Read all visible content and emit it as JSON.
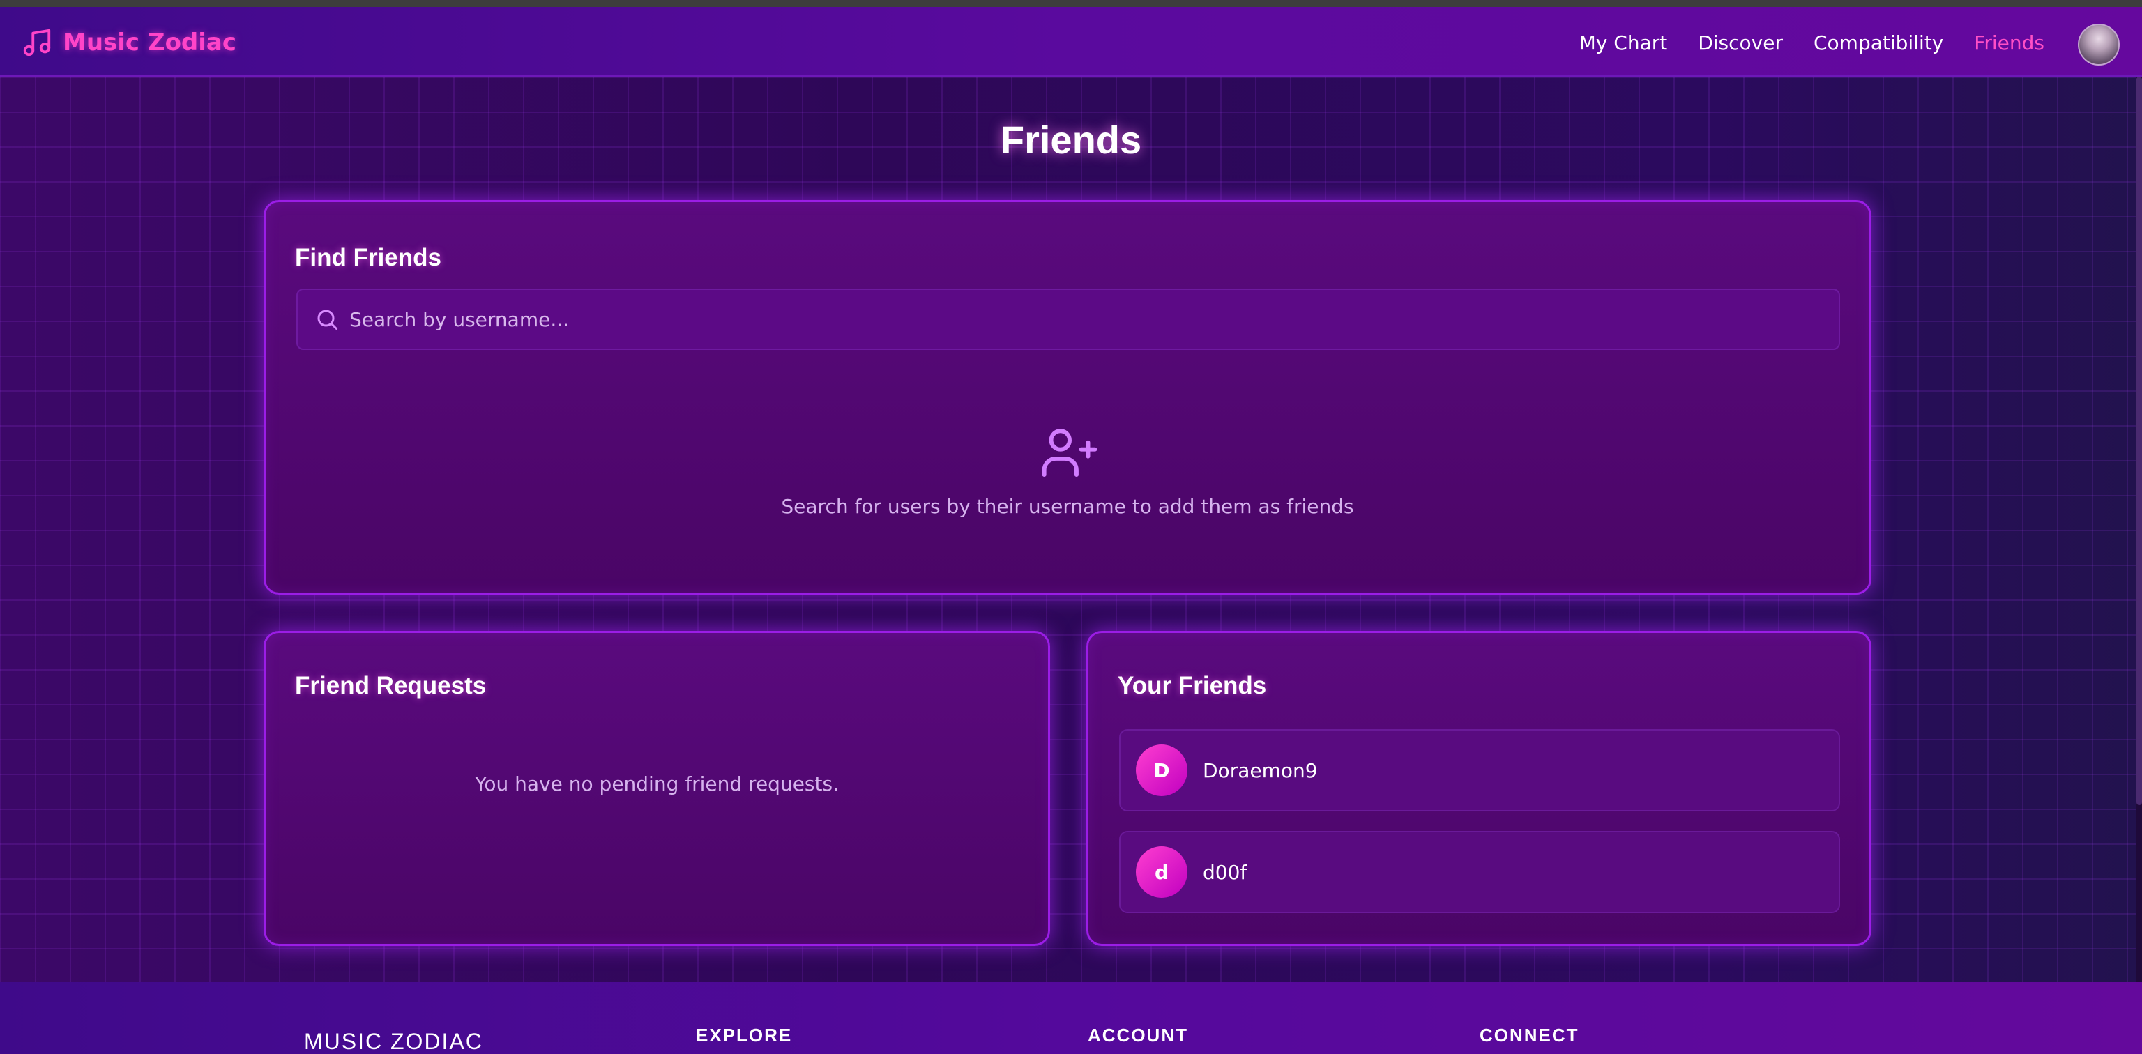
{
  "app": {
    "name": "Music Zodiac",
    "logo_icon": "music-note-icon"
  },
  "nav": {
    "items": [
      {
        "label": "My Chart",
        "active": false
      },
      {
        "label": "Discover",
        "active": false
      },
      {
        "label": "Compatibility",
        "active": false
      },
      {
        "label": "Friends",
        "active": true
      }
    ],
    "profile_icon": "user-avatar"
  },
  "page": {
    "title": "Friends"
  },
  "find_friends": {
    "title": "Find Friends",
    "search_placeholder": "Search by username...",
    "search_value": "",
    "search_icon": "search-icon",
    "empty_icon": "user-plus-icon",
    "hint": "Search for users by their username to add them as friends"
  },
  "friend_requests": {
    "title": "Friend Requests",
    "empty_message": "You have no pending friend requests."
  },
  "your_friends": {
    "title": "Your Friends",
    "friends": [
      {
        "initial": "D",
        "name": "Doraemon9"
      },
      {
        "initial": "d",
        "name": "d00f"
      }
    ]
  },
  "footer": {
    "brand": "MUSIC ZODIAC",
    "columns": [
      "EXPLORE",
      "ACCOUNT",
      "CONNECT"
    ]
  },
  "colors": {
    "accent_pink": "#ff4fc6",
    "card_border": "#9b1de6",
    "background": "#35095c"
  }
}
